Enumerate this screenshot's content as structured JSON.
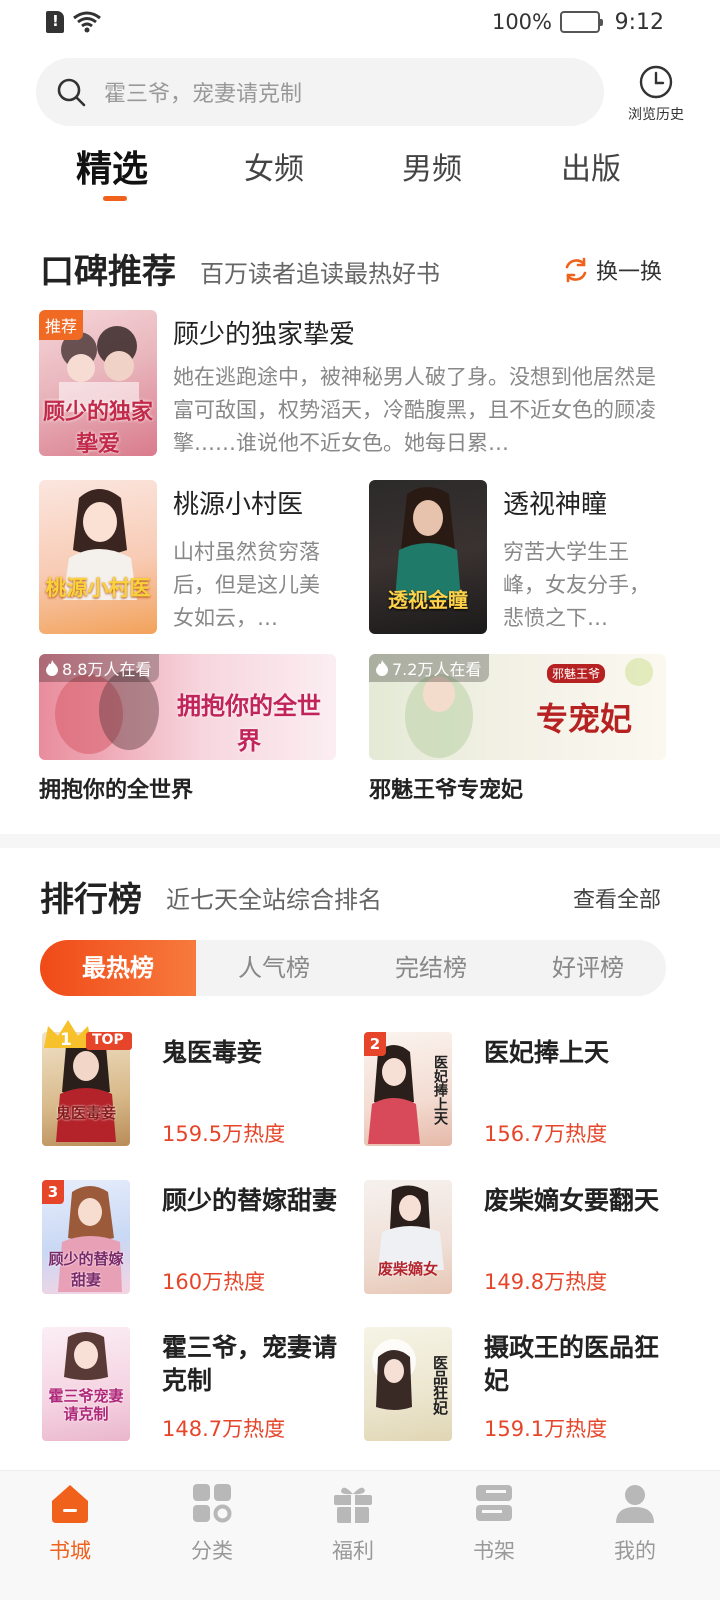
{
  "status_bar": {
    "battery": "100%",
    "time": "9:12"
  },
  "search": {
    "placeholder": "霍三爷，宠妻请克制",
    "history_label": "浏览历史"
  },
  "tabs": [
    {
      "label": "精选",
      "active": true
    },
    {
      "label": "女频"
    },
    {
      "label": "男频"
    },
    {
      "label": "出版"
    }
  ],
  "recommend": {
    "title": "口碑推荐",
    "subtitle": "百万读者追读最热好书",
    "action": "换一换",
    "badge": "推荐",
    "featured": {
      "name": "顾少的独家挚爱",
      "cover_text": "顾少的独家挚爱",
      "description": "她在逃跑途中，被神秘男人破了身。没想到他居然是富可敌国，权势滔天，冷酷腹黑，且不近女色的顾凌擎……谁说他不近女色。她每日累…"
    },
    "books": [
      {
        "name": "桃源小村医",
        "cover_text": "桃源小村医",
        "description": "山村虽然贫穷落后，但是这儿美女如云，…"
      },
      {
        "name": "透视神瞳",
        "cover_text": "透视金瞳",
        "description": "穷苦大学生王峰，女友分手，悲愤之下…"
      }
    ],
    "banners": [
      {
        "viewers": "8.8万人在看",
        "cover_text": "拥抱你的全世界",
        "title": "拥抱你的全世界"
      },
      {
        "viewers": "7.2万人在看",
        "cover_text": "专宠妃",
        "cover_tag": "邪魅王爷",
        "title": "邪魅王爷专宠妃"
      }
    ]
  },
  "ranking": {
    "title": "排行榜",
    "subtitle": "近七天全站综合排名",
    "action": "查看全部",
    "tabs": [
      {
        "label": "最热榜",
        "active": true
      },
      {
        "label": "人气榜"
      },
      {
        "label": "完结榜"
      },
      {
        "label": "好评榜"
      }
    ],
    "top_badge": "TOP",
    "items": [
      {
        "rank": "1",
        "name": "鬼医毒妾",
        "heat": "159.5万热度",
        "cover_text": "鬼医毒妾"
      },
      {
        "rank": "2",
        "name": "医妃捧上天",
        "heat": "156.7万热度",
        "cover_text": "医妃捧上天"
      },
      {
        "rank": "3",
        "name": "顾少的替嫁甜妻",
        "heat": "160万热度",
        "cover_text": "顾少的替嫁甜妻"
      },
      {
        "rank": "",
        "name": "废柴嫡女要翻天",
        "heat": "149.8万热度",
        "cover_text": "废柴嫡女"
      },
      {
        "rank": "",
        "name": "霍三爷，宠妻请克制",
        "heat": "148.7万热度",
        "cover_text": "霍三爷宠妻请克制"
      },
      {
        "rank": "",
        "name": "摄政王的医品狂妃",
        "heat": "159.1万热度",
        "cover_text": "医品狂妃"
      }
    ]
  },
  "bottom_nav": [
    {
      "label": "书城",
      "icon": "home-icon",
      "active": true
    },
    {
      "label": "分类",
      "icon": "category-icon"
    },
    {
      "label": "福利",
      "icon": "gift-icon"
    },
    {
      "label": "书架",
      "icon": "bookshelf-icon"
    },
    {
      "label": "我的",
      "icon": "profile-icon"
    }
  ],
  "colors": {
    "accent": "#f0621c",
    "heat": "#e6452a"
  }
}
